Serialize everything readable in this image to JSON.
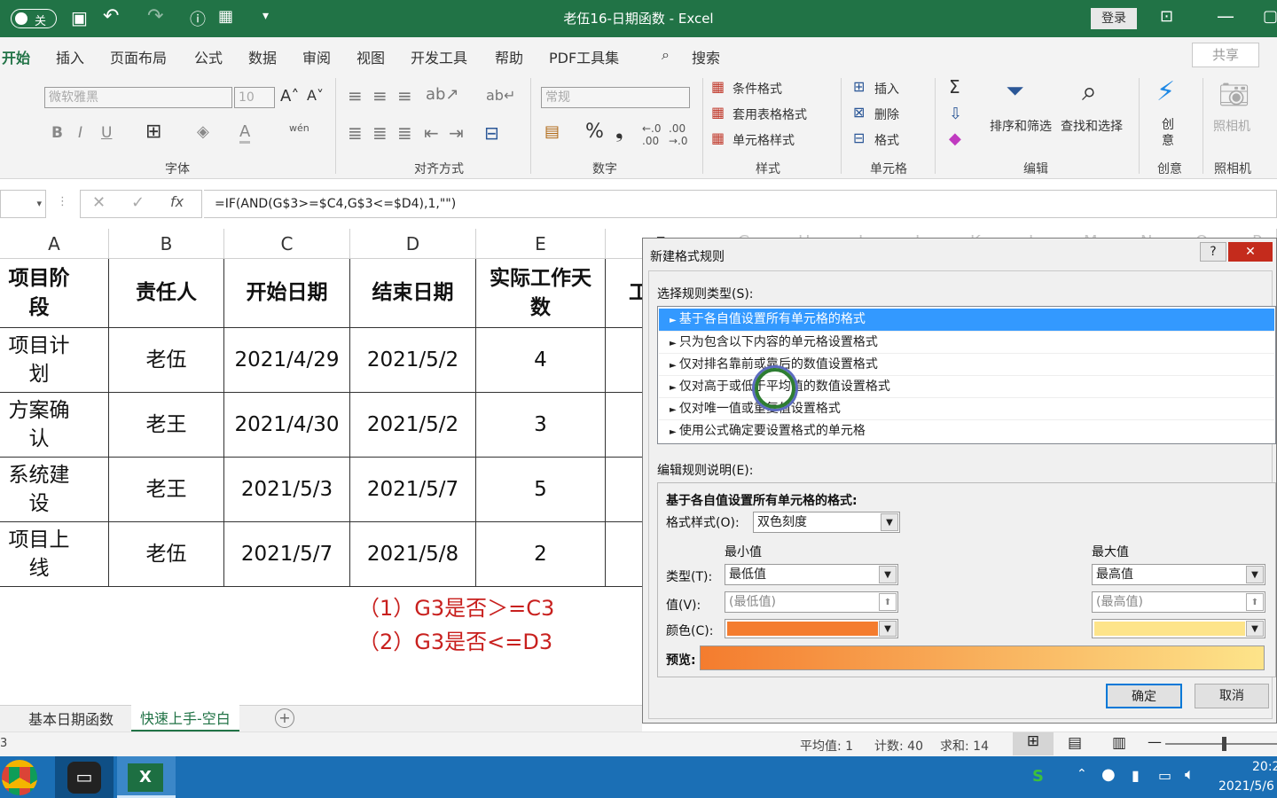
{
  "window": {
    "title": "老伍16-日期函数 - Excel",
    "autosave_state": "关",
    "login": "登录"
  },
  "menu": {
    "tabs": [
      "开始",
      "插入",
      "页面布局",
      "公式",
      "数据",
      "审阅",
      "视图",
      "开发工具",
      "帮助",
      "PDF工具集"
    ],
    "search": "搜索",
    "share": "共享"
  },
  "ribbon": {
    "font_name": "微软雅黑",
    "font_size": "10",
    "number_format": "常规",
    "wen": "wén",
    "groups": [
      "字体",
      "对齐方式",
      "数字",
      "样式",
      "单元格",
      "编辑",
      "创意",
      "照相机"
    ],
    "styles": [
      "条件格式",
      "套用表格格式",
      "单元格样式"
    ],
    "cells": [
      "插入",
      "删除",
      "格式"
    ],
    "sort_filter": "排序和筛选",
    "find_select": "查找和选择",
    "create": "创意",
    "camera": "照相机"
  },
  "formula_bar": {
    "fx": "fx",
    "formula": "=IF(AND(G$3>=$C4,G$3<=$D4),1,\"\")"
  },
  "columns": [
    "A",
    "B",
    "C",
    "D",
    "E",
    "F"
  ],
  "right_columns": [
    "G",
    "H",
    "I",
    "J",
    "K",
    "L",
    "M",
    "N",
    "O",
    "P"
  ],
  "table": {
    "headers": [
      "项目阶段",
      "责任人",
      "开始日期",
      "结束日期",
      "实际工作天数",
      "工"
    ],
    "rows": [
      [
        "项目计划",
        "老伍",
        "2021/4/29",
        "2021/5/2",
        "4"
      ],
      [
        "方案确认",
        "老王",
        "2021/4/30",
        "2021/5/2",
        "3"
      ],
      [
        "系统建设",
        "老王",
        "2021/5/3",
        "2021/5/7",
        "5"
      ],
      [
        "项目上线",
        "老伍",
        "2021/5/7",
        "2021/5/8",
        "2"
      ]
    ]
  },
  "notes": [
    "（1）G3是否＞=C3",
    "（2）G3是否<=D3"
  ],
  "sheet_tabs": [
    "基本日期函数",
    "快速上手-空白"
  ],
  "status": {
    "avg": "平均值: 1",
    "count": "计数: 40",
    "sum": "求和: 14",
    "left_cell": "3"
  },
  "taskbar": {
    "time": "20:2",
    "date": "2021/5/6"
  },
  "dialog": {
    "title": "新建格式规则",
    "help": "?",
    "close": "✕",
    "rule_type_label": "选择规则类型(S):",
    "rule_types": [
      "基于各自值设置所有单元格的格式",
      "只为包含以下内容的单元格设置格式",
      "仅对排名靠前或靠后的数值设置格式",
      "仅对高于或低于平均值的数值设置格式",
      "仅对唯一值或重复值设置格式",
      "使用公式确定要设置格式的单元格"
    ],
    "edit_label": "编辑规则说明(E):",
    "edit_heading": "基于各自值设置所有单元格的格式:",
    "style_label": "格式样式(O):",
    "style_value": "双色刻度",
    "min_label": "最小值",
    "max_label": "最大值",
    "type_label": "类型(T):",
    "min_type": "最低值",
    "max_type": "最高值",
    "value_label": "值(V):",
    "min_value": "(最低值)",
    "max_value": "(最高值)",
    "color_label": "颜色(C):",
    "min_color": "#f47c2e",
    "max_color": "#fde48a",
    "preview_label": "预览:",
    "ok": "确定",
    "cancel": "取消"
  }
}
